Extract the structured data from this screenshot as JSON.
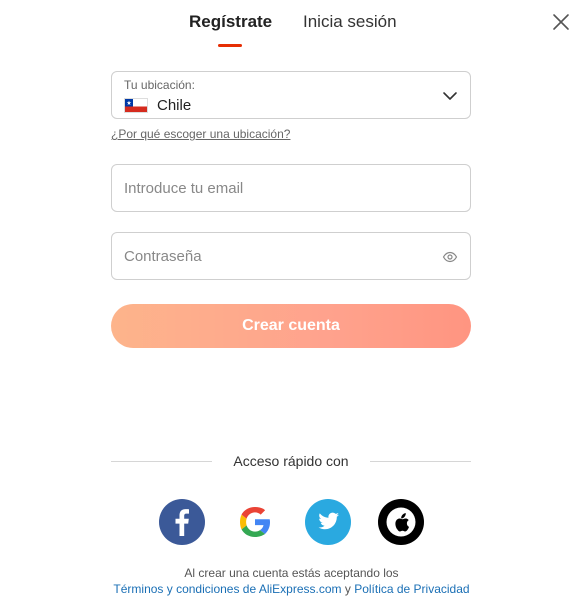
{
  "tabs": {
    "register": "Regístrate",
    "login": "Inicia sesión",
    "active": "register",
    "underline_color": "#e62e04"
  },
  "close_icon": "close-icon",
  "location": {
    "label": "Tu ubicación:",
    "value": "Chile",
    "flag_icon": "chile-flag-icon"
  },
  "why_link": "¿Por qué escoger una ubicación?",
  "email": {
    "placeholder": "Introduce tu email",
    "value": ""
  },
  "password": {
    "placeholder": "Contraseña",
    "value": "",
    "toggle_icon": "eye-icon"
  },
  "create_button": {
    "label": "Crear cuenta",
    "gradient": [
      "#fdb085",
      "#ff8f7a"
    ]
  },
  "quick_access": {
    "label": "Acceso rápido con",
    "providers": [
      "facebook-icon",
      "google-icon",
      "twitter-icon",
      "apple-icon"
    ]
  },
  "legal": {
    "line1": "Al crear una cuenta estás aceptando los",
    "terms_link": "Términos y condiciones de AliExpress.com",
    "conjunction": "y",
    "privacy_link": "Política de Privacidad",
    "link_color": "#1a6fb5"
  }
}
